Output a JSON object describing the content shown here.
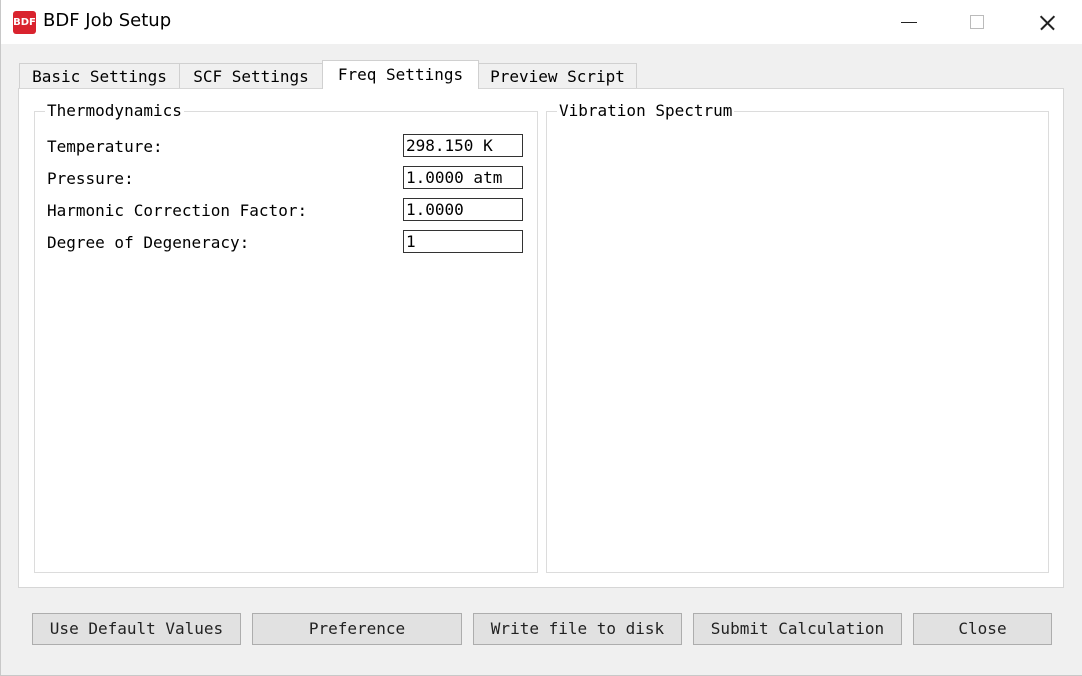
{
  "window": {
    "title": "BDF Job Setup",
    "icon": "bdf-app-icon"
  },
  "tabs": [
    {
      "label": "Basic Settings",
      "active": false
    },
    {
      "label": "SCF Settings",
      "active": false
    },
    {
      "label": "Freq Settings",
      "active": true
    },
    {
      "label": "Preview Script",
      "active": false
    }
  ],
  "thermodynamics": {
    "title": "Thermodynamics",
    "fields": [
      {
        "label": "Temperature:",
        "value": "298.150 K"
      },
      {
        "label": "Pressure:",
        "value": "1.0000 atm"
      },
      {
        "label": "Harmonic Correction Factor:",
        "value": "1.0000"
      },
      {
        "label": "Degree of Degeneracy:",
        "value": "1"
      }
    ]
  },
  "spectrum": {
    "title": "Vibration Spectrum"
  },
  "buttons": {
    "defaults": "Use Default Values",
    "preference": "Preference",
    "write": "Write file to disk",
    "submit": "Submit Calculation",
    "close": "Close"
  }
}
